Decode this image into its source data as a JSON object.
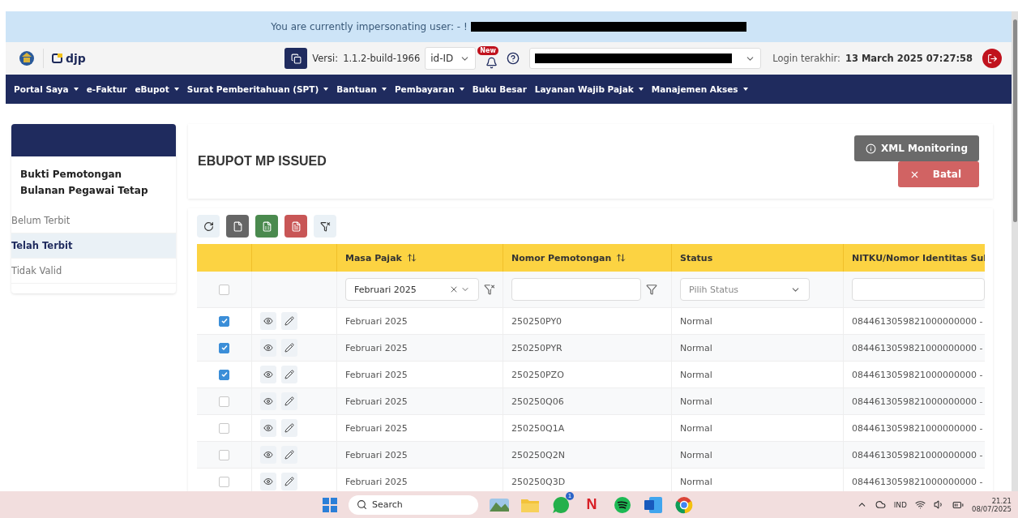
{
  "banner": {
    "text": "You are currently impersonating user: - !",
    "redacted": true
  },
  "header": {
    "logo_text": "djp",
    "version_label": "Versi:",
    "version": "1.1.2-build-1966",
    "language": "id-ID",
    "badge": "New",
    "account_redacted": true,
    "login_label": "Login terakhir:",
    "login_time": "13 March 2025 07:27:58"
  },
  "nav": [
    {
      "label": "Portal Saya",
      "dropdown": true
    },
    {
      "label": "e-Faktur",
      "dropdown": false
    },
    {
      "label": "eBupot",
      "dropdown": true
    },
    {
      "label": "Surat Pemberitahuan (SPT)",
      "dropdown": true
    },
    {
      "label": "Bantuan",
      "dropdown": true
    },
    {
      "label": "Pembayaran",
      "dropdown": true
    },
    {
      "label": "Buku Besar",
      "dropdown": false
    },
    {
      "label": "Layanan Wajib Pajak",
      "dropdown": true
    },
    {
      "label": "Manajemen Akses",
      "dropdown": true
    }
  ],
  "sidebar": {
    "title": "Bukti Pemotongan Bulanan Pegawai Tetap",
    "items": [
      {
        "label": "Belum Terbit",
        "selected": false
      },
      {
        "label": "Telah Terbit",
        "selected": true
      },
      {
        "label": "Tidak Valid",
        "selected": false
      }
    ]
  },
  "main": {
    "title": "EBUPOT MP ISSUED",
    "buttons": [
      {
        "label": "XML Monitoring",
        "kind": "info"
      },
      {
        "label": "Batal",
        "kind": "cancel"
      }
    ]
  },
  "toolbar": [
    {
      "kind": "refresh"
    },
    {
      "kind": "file"
    },
    {
      "kind": "excel"
    },
    {
      "kind": "pdf"
    },
    {
      "kind": "clear-filter"
    }
  ],
  "table": {
    "columns": [
      {
        "kind": "select"
      },
      {
        "kind": "actions"
      },
      {
        "kind": "data",
        "label": "Masa Pajak",
        "sortable": true
      },
      {
        "kind": "data",
        "label": "Nomor Pemotongan",
        "sortable": true
      },
      {
        "kind": "data",
        "label": "Status",
        "sortable": false
      },
      {
        "kind": "data",
        "label": "NITKU/Nomor Identitas Sul"
      }
    ],
    "filters": {
      "select_all_checked": false,
      "masa_value": "Februari 2025",
      "status_placeholder": "Pilih Status"
    },
    "rows": [
      {
        "checked": true,
        "masa": "Februari 2025",
        "nomor": "250250PY0",
        "status": "Normal",
        "nitku": "0844613059821000000000 -"
      },
      {
        "checked": true,
        "masa": "Februari 2025",
        "nomor": "250250PYR",
        "status": "Normal",
        "nitku": "0844613059821000000000 -"
      },
      {
        "checked": true,
        "masa": "Februari 2025",
        "nomor": "250250PZO",
        "status": "Normal",
        "nitku": "0844613059821000000000 -"
      },
      {
        "checked": false,
        "masa": "Februari 2025",
        "nomor": "250250Q06",
        "status": "Normal",
        "nitku": "0844613059821000000000 -"
      },
      {
        "checked": false,
        "masa": "Februari 2025",
        "nomor": "250250Q1A",
        "status": "Normal",
        "nitku": "0844613059821000000000 -"
      },
      {
        "checked": false,
        "masa": "Februari 2025",
        "nomor": "250250Q2N",
        "status": "Normal",
        "nitku": "0844613059821000000000 -"
      },
      {
        "checked": false,
        "masa": "Februari 2025",
        "nomor": "250250Q3D",
        "status": "Normal",
        "nitku": "0844613059821000000000 -"
      }
    ]
  },
  "taskbar": {
    "search": "Search",
    "apps": [
      {
        "kind": "widget"
      },
      {
        "kind": "folder"
      },
      {
        "kind": "chat",
        "badge": "1"
      },
      {
        "kind": "letter",
        "glyph": "N"
      },
      {
        "kind": "music"
      },
      {
        "kind": "word"
      },
      {
        "kind": "browser"
      }
    ],
    "language": "IND",
    "time": "21.21",
    "date": "08/07/2025"
  }
}
